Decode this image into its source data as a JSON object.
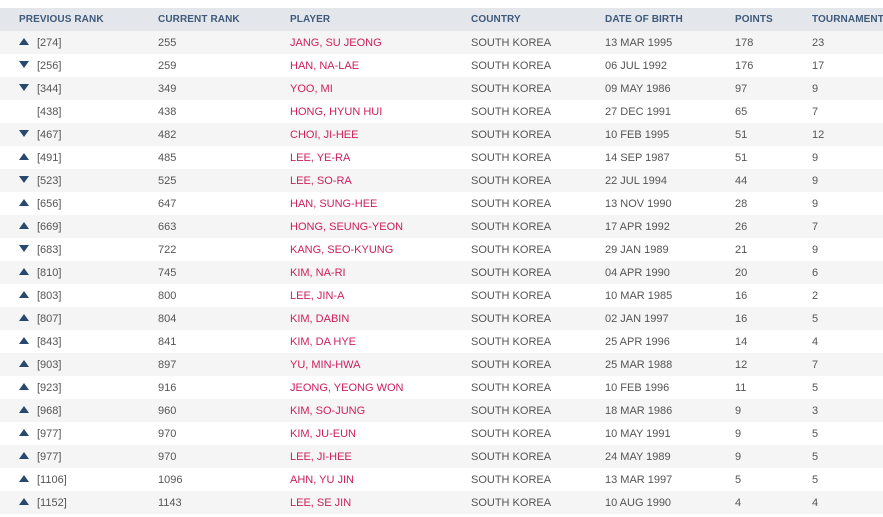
{
  "columns": {
    "previous_rank": "PREVIOUS RANK",
    "current_rank": "CURRENT RANK",
    "player": "PLAYER",
    "country": "COUNTRY",
    "dob": "DATE OF BIRTH",
    "points": "POINTS",
    "tournaments": "TOURNAMENTS"
  },
  "colors": {
    "header_bg": "#e3e6eb",
    "header_text": "#3f5a7a",
    "player_link": "#cc1f5c",
    "arrow": "#27486f",
    "stripe": "#f5f5f5"
  },
  "rows": [
    {
      "trend": "up",
      "prev": "[274]",
      "current": "255",
      "player": "JANG, SU JEONG",
      "country": "SOUTH KOREA",
      "dob": "13 MAR 1995",
      "points": "178",
      "tournaments": "23"
    },
    {
      "trend": "down",
      "prev": "[256]",
      "current": "259",
      "player": "HAN, NA-LAE",
      "country": "SOUTH KOREA",
      "dob": "06 JUL 1992",
      "points": "176",
      "tournaments": "17"
    },
    {
      "trend": "down",
      "prev": "[344]",
      "current": "349",
      "player": "YOO, MI",
      "country": "SOUTH KOREA",
      "dob": "09 MAY 1986",
      "points": "97",
      "tournaments": "9"
    },
    {
      "trend": "none",
      "prev": "[438]",
      "current": "438",
      "player": "HONG, HYUN HUI",
      "country": "SOUTH KOREA",
      "dob": "27 DEC 1991",
      "points": "65",
      "tournaments": "7"
    },
    {
      "trend": "down",
      "prev": "[467]",
      "current": "482",
      "player": "CHOI, JI-HEE",
      "country": "SOUTH KOREA",
      "dob": "10 FEB 1995",
      "points": "51",
      "tournaments": "12"
    },
    {
      "trend": "up",
      "prev": "[491]",
      "current": "485",
      "player": "LEE, YE-RA",
      "country": "SOUTH KOREA",
      "dob": "14 SEP 1987",
      "points": "51",
      "tournaments": "9"
    },
    {
      "trend": "down",
      "prev": "[523]",
      "current": "525",
      "player": "LEE, SO-RA",
      "country": "SOUTH KOREA",
      "dob": "22 JUL 1994",
      "points": "44",
      "tournaments": "9"
    },
    {
      "trend": "up",
      "prev": "[656]",
      "current": "647",
      "player": "HAN, SUNG-HEE",
      "country": "SOUTH KOREA",
      "dob": "13 NOV 1990",
      "points": "28",
      "tournaments": "9"
    },
    {
      "trend": "up",
      "prev": "[669]",
      "current": "663",
      "player": "HONG, SEUNG-YEON",
      "country": "SOUTH KOREA",
      "dob": "17 APR 1992",
      "points": "26",
      "tournaments": "7"
    },
    {
      "trend": "down",
      "prev": "[683]",
      "current": "722",
      "player": "KANG, SEO-KYUNG",
      "country": "SOUTH KOREA",
      "dob": "29 JAN 1989",
      "points": "21",
      "tournaments": "9"
    },
    {
      "trend": "up",
      "prev": "[810]",
      "current": "745",
      "player": "KIM, NA-RI",
      "country": "SOUTH KOREA",
      "dob": "04 APR 1990",
      "points": "20",
      "tournaments": "6"
    },
    {
      "trend": "up",
      "prev": "[803]",
      "current": "800",
      "player": "LEE, JIN-A",
      "country": "SOUTH KOREA",
      "dob": "10 MAR 1985",
      "points": "16",
      "tournaments": "2"
    },
    {
      "trend": "up",
      "prev": "[807]",
      "current": "804",
      "player": "KIM, DABIN",
      "country": "SOUTH KOREA",
      "dob": "02 JAN 1997",
      "points": "16",
      "tournaments": "5"
    },
    {
      "trend": "up",
      "prev": "[843]",
      "current": "841",
      "player": "KIM, DA HYE",
      "country": "SOUTH KOREA",
      "dob": "25 APR 1996",
      "points": "14",
      "tournaments": "4"
    },
    {
      "trend": "up",
      "prev": "[903]",
      "current": "897",
      "player": "YU, MIN-HWA",
      "country": "SOUTH KOREA",
      "dob": "25 MAR 1988",
      "points": "12",
      "tournaments": "7"
    },
    {
      "trend": "up",
      "prev": "[923]",
      "current": "916",
      "player": "JEONG, YEONG WON",
      "country": "SOUTH KOREA",
      "dob": "10 FEB 1996",
      "points": "11",
      "tournaments": "5"
    },
    {
      "trend": "up",
      "prev": "[968]",
      "current": "960",
      "player": "KIM, SO-JUNG",
      "country": "SOUTH KOREA",
      "dob": "18 MAR 1986",
      "points": "9",
      "tournaments": "3"
    },
    {
      "trend": "up",
      "prev": "[977]",
      "current": "970",
      "player": "KIM, JU-EUN",
      "country": "SOUTH KOREA",
      "dob": "10 MAY 1991",
      "points": "9",
      "tournaments": "5"
    },
    {
      "trend": "up",
      "prev": "[977]",
      "current": "970",
      "player": "LEE, JI-HEE",
      "country": "SOUTH KOREA",
      "dob": "24 MAY 1989",
      "points": "9",
      "tournaments": "5"
    },
    {
      "trend": "up",
      "prev": "[1106]",
      "current": "1096",
      "player": "AHN, YU JIN",
      "country": "SOUTH KOREA",
      "dob": "13 MAR 1997",
      "points": "5",
      "tournaments": "5"
    },
    {
      "trend": "up",
      "prev": "[1152]",
      "current": "1143",
      "player": "LEE, SE JIN",
      "country": "SOUTH KOREA",
      "dob": "10 AUG 1990",
      "points": "4",
      "tournaments": "4"
    }
  ]
}
